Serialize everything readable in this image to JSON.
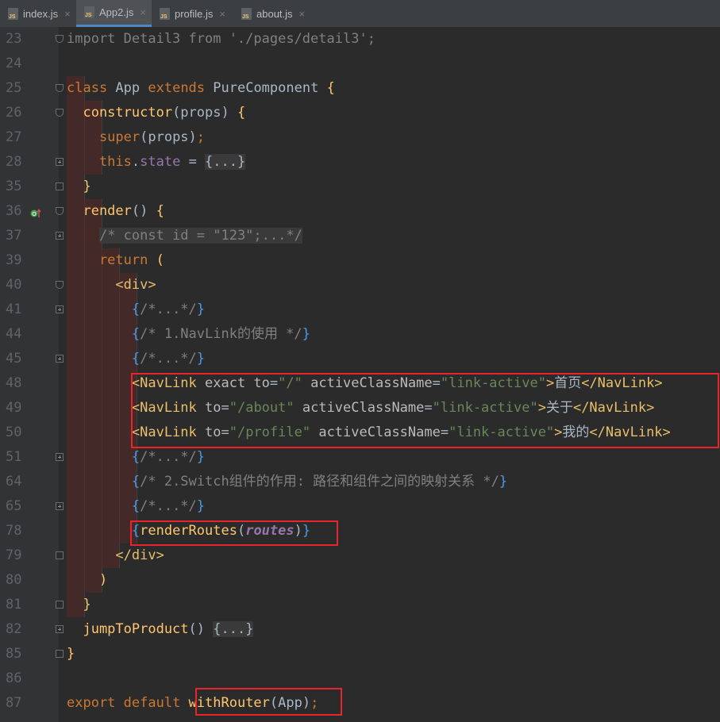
{
  "tabs": [
    {
      "label": "index.js",
      "active": false
    },
    {
      "label": "App2.js",
      "active": true
    },
    {
      "label": "profile.js",
      "active": false
    },
    {
      "label": "about.js",
      "active": false
    }
  ],
  "gutter_icon": "override-method-icon",
  "lines": [
    {
      "num": "23",
      "fold": "open",
      "tokens": [
        {
          "t": "import Detail3 from './pages/detail3';",
          "c": "cm"
        }
      ]
    },
    {
      "num": "24",
      "fold": null,
      "tokens": []
    },
    {
      "num": "25",
      "fold": "open",
      "tokens": [
        {
          "t": "class ",
          "c": "kw"
        },
        {
          "t": "App ",
          "c": "txt"
        },
        {
          "t": "extends ",
          "c": "kw"
        },
        {
          "t": "PureComponent ",
          "c": "txt"
        },
        {
          "t": "{",
          "c": "fn"
        }
      ]
    },
    {
      "num": "26",
      "fold": "open",
      "tokens": [
        {
          "t": "  constructor",
          "c": "fn"
        },
        {
          "t": "(props) ",
          "c": "txt"
        },
        {
          "t": "{",
          "c": "fn"
        }
      ]
    },
    {
      "num": "27",
      "fold": null,
      "tokens": [
        {
          "t": "    super",
          "c": "kw"
        },
        {
          "t": "(props)",
          "c": "txt"
        },
        {
          "t": ";",
          "c": "kw"
        }
      ]
    },
    {
      "num": "28",
      "fold": "plus",
      "tokens": [
        {
          "t": "    this",
          "c": "kw"
        },
        {
          "t": ".",
          "c": "txt"
        },
        {
          "t": "state",
          "c": "prop"
        },
        {
          "t": " = ",
          "c": "txt"
        },
        {
          "t": "{...}",
          "c": "fld"
        }
      ]
    },
    {
      "num": "35",
      "fold": "closed",
      "tokens": [
        {
          "t": "  }",
          "c": "fn"
        }
      ]
    },
    {
      "num": "36",
      "fold": "open",
      "tokens": [
        {
          "t": "  render",
          "c": "fn"
        },
        {
          "t": "() ",
          "c": "txt"
        },
        {
          "t": "{",
          "c": "fn"
        }
      ]
    },
    {
      "num": "37",
      "fold": "plus",
      "tokens": [
        {
          "t": "    ",
          "c": "txt"
        },
        {
          "t": "/* const id = \"123\";...*/",
          "c": "fldcm"
        }
      ]
    },
    {
      "num": "39",
      "fold": null,
      "tokens": [
        {
          "t": "    return ",
          "c": "kw"
        },
        {
          "t": "(",
          "c": "fn"
        }
      ]
    },
    {
      "num": "40",
      "fold": "open",
      "tokens": [
        {
          "t": "      <div>",
          "c": "tag"
        }
      ]
    },
    {
      "num": "41",
      "fold": "plus",
      "tokens": [
        {
          "t": "        {",
          "c": "brace"
        },
        {
          "t": "/*...*/",
          "c": "cm"
        },
        {
          "t": "}",
          "c": "brace"
        }
      ]
    },
    {
      "num": "44",
      "fold": null,
      "tokens": [
        {
          "t": "        {",
          "c": "brace"
        },
        {
          "t": "/* 1.NavLink的使用 */",
          "c": "cm"
        },
        {
          "t": "}",
          "c": "brace"
        }
      ]
    },
    {
      "num": "45",
      "fold": "plus",
      "tokens": [
        {
          "t": "        {",
          "c": "brace"
        },
        {
          "t": "/*...*/",
          "c": "cm"
        },
        {
          "t": "}",
          "c": "brace"
        }
      ]
    },
    {
      "num": "48",
      "fold": null,
      "tokens": [
        {
          "t": "        <NavLink ",
          "c": "tag"
        },
        {
          "t": "exact ",
          "c": "attr"
        },
        {
          "t": "to",
          "c": "attr"
        },
        {
          "t": "=",
          "c": "txt"
        },
        {
          "t": "\"/\" ",
          "c": "str"
        },
        {
          "t": "activeClassName",
          "c": "attr"
        },
        {
          "t": "=",
          "c": "txt"
        },
        {
          "t": "\"link-active\"",
          "c": "str"
        },
        {
          "t": ">",
          "c": "tag"
        },
        {
          "t": "首页",
          "c": "txt"
        },
        {
          "t": "</NavLink>",
          "c": "tag"
        }
      ]
    },
    {
      "num": "49",
      "fold": null,
      "tokens": [
        {
          "t": "        <NavLink ",
          "c": "tag"
        },
        {
          "t": "to",
          "c": "attr"
        },
        {
          "t": "=",
          "c": "txt"
        },
        {
          "t": "\"/about\" ",
          "c": "str"
        },
        {
          "t": "activeClassName",
          "c": "attr"
        },
        {
          "t": "=",
          "c": "txt"
        },
        {
          "t": "\"link-active\"",
          "c": "str"
        },
        {
          "t": ">",
          "c": "tag"
        },
        {
          "t": "关于",
          "c": "txt"
        },
        {
          "t": "</NavLink>",
          "c": "tag"
        }
      ]
    },
    {
      "num": "50",
      "fold": null,
      "tokens": [
        {
          "t": "        <NavLink ",
          "c": "tag"
        },
        {
          "t": "to",
          "c": "attr"
        },
        {
          "t": "=",
          "c": "txt"
        },
        {
          "t": "\"/profile\" ",
          "c": "str"
        },
        {
          "t": "activeClassName",
          "c": "attr"
        },
        {
          "t": "=",
          "c": "txt"
        },
        {
          "t": "\"link-active\"",
          "c": "str"
        },
        {
          "t": ">",
          "c": "tag"
        },
        {
          "t": "我的",
          "c": "txt"
        },
        {
          "t": "</NavLink>",
          "c": "tag"
        }
      ]
    },
    {
      "num": "51",
      "fold": "plus",
      "tokens": [
        {
          "t": "        {",
          "c": "brace"
        },
        {
          "t": "/*...*/",
          "c": "cm"
        },
        {
          "t": "}",
          "c": "brace"
        }
      ]
    },
    {
      "num": "64",
      "fold": null,
      "tokens": [
        {
          "t": "        {",
          "c": "brace"
        },
        {
          "t": "/* 2.Switch组件的作用: 路径和组件之间的映射关系 */",
          "c": "cm"
        },
        {
          "t": "}",
          "c": "brace"
        }
      ]
    },
    {
      "num": "65",
      "fold": "plus",
      "tokens": [
        {
          "t": "        {",
          "c": "brace"
        },
        {
          "t": "/*...*/",
          "c": "cm"
        },
        {
          "t": "}",
          "c": "brace"
        }
      ]
    },
    {
      "num": "78",
      "fold": null,
      "tokens": [
        {
          "t": "        {",
          "c": "brace"
        },
        {
          "t": "renderRoutes",
          "c": "fn"
        },
        {
          "t": "(",
          "c": "txt"
        },
        {
          "t": "routes",
          "c": "italic"
        },
        {
          "t": ")",
          "c": "txt"
        },
        {
          "t": "}",
          "c": "brace"
        }
      ]
    },
    {
      "num": "79",
      "fold": "closed",
      "tokens": [
        {
          "t": "      </div>",
          "c": "tag"
        }
      ]
    },
    {
      "num": "80",
      "fold": null,
      "tokens": [
        {
          "t": "    )",
          "c": "fn"
        }
      ]
    },
    {
      "num": "81",
      "fold": "closed",
      "tokens": [
        {
          "t": "  }",
          "c": "fn"
        }
      ]
    },
    {
      "num": "82",
      "fold": "plus",
      "tokens": [
        {
          "t": "  jumpToProduct",
          "c": "fn"
        },
        {
          "t": "() ",
          "c": "txt"
        },
        {
          "t": "{...}",
          "c": "fld"
        }
      ]
    },
    {
      "num": "85",
      "fold": "closed",
      "tokens": [
        {
          "t": "}",
          "c": "fn"
        }
      ]
    },
    {
      "num": "86",
      "fold": null,
      "tokens": []
    },
    {
      "num": "87",
      "fold": null,
      "tokens": [
        {
          "t": "export ",
          "c": "kw"
        },
        {
          "t": "default ",
          "c": "kw"
        },
        {
          "t": "withRouter",
          "c": "fn"
        },
        {
          "t": "(App)",
          "c": "txt"
        },
        {
          "t": ";",
          "c": "kw"
        }
      ]
    }
  ],
  "highlight_boxes": [
    {
      "label": "navlink-block"
    },
    {
      "label": "render-routes"
    },
    {
      "label": "with-router"
    }
  ]
}
